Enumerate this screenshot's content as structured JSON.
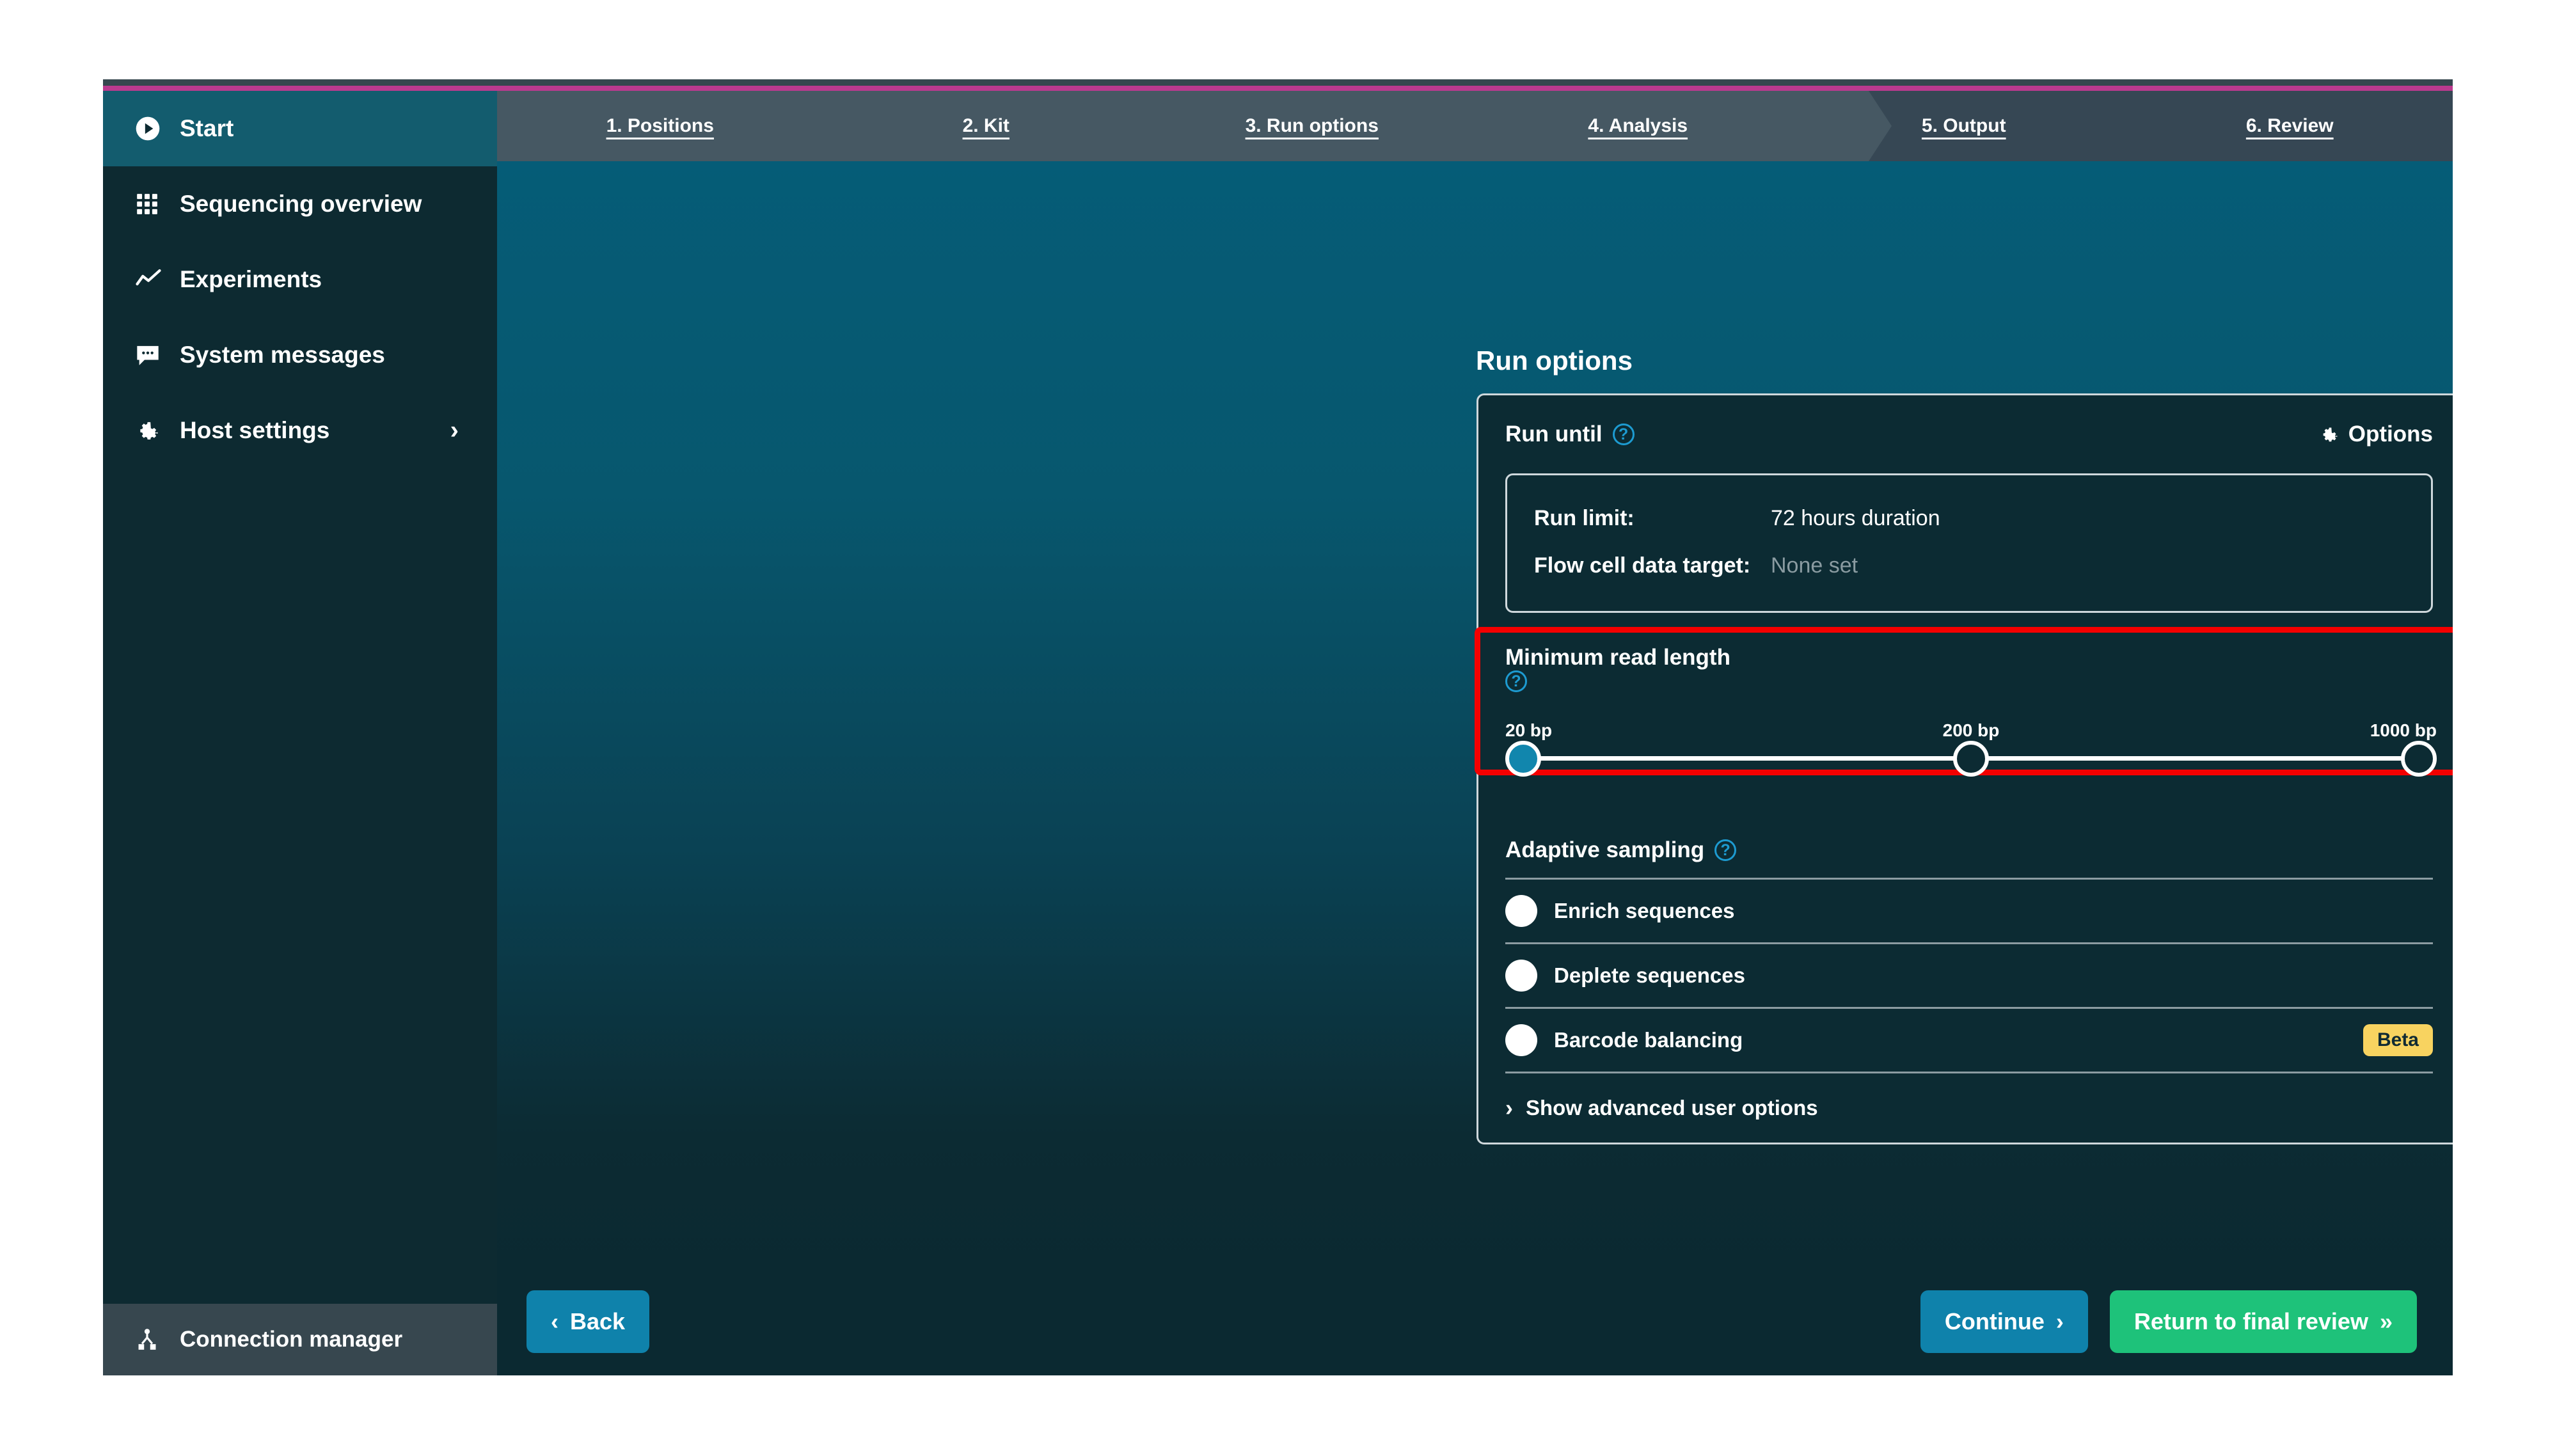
{
  "window": {
    "accent_magenta": "#bb3a8f",
    "accent_teal": "#0f82ab",
    "accent_green": "#1ec27a",
    "highlight_red": "#f40000",
    "badge_yellow": "#f8d360"
  },
  "sidebar": {
    "items": [
      {
        "label": "Start",
        "icon": "play-circle-icon",
        "active": true,
        "chevron": ""
      },
      {
        "label": "Sequencing overview",
        "icon": "grid-icon",
        "active": false,
        "chevron": ""
      },
      {
        "label": "Experiments",
        "icon": "line-chart-icon",
        "active": false,
        "chevron": ""
      },
      {
        "label": "System messages",
        "icon": "message-icon",
        "active": false,
        "chevron": ""
      },
      {
        "label": "Host settings",
        "icon": "gear-icon",
        "active": false,
        "chevron": "›"
      }
    ],
    "connection_manager": {
      "label": "Connection manager",
      "icon": "network-node-icon"
    }
  },
  "tabbar": {
    "tabs": [
      {
        "label": "1. Positions"
      },
      {
        "label": "2. Kit"
      },
      {
        "label": "3. Run options"
      },
      {
        "label": "4. Analysis"
      },
      {
        "label": "5. Output"
      },
      {
        "label": "6. Review"
      }
    ],
    "active_index": 2
  },
  "main": {
    "page_title": "Run options",
    "run_until": {
      "title": "Run until",
      "help_icon": "help-circle-icon",
      "options_label": "Options",
      "options_icon": "gear-icon",
      "rows": [
        {
          "key": "Run limit:",
          "value": "72 hours duration",
          "muted": false
        },
        {
          "key": "Flow cell data target:",
          "value": "None set",
          "muted": true
        }
      ]
    },
    "minimum_read_length": {
      "title": "Minimum read length",
      "help_icon": "help-circle-icon",
      "highlighted": true,
      "stops": [
        {
          "label": "20 bp",
          "value": 20,
          "selected": true
        },
        {
          "label": "200 bp",
          "value": 200,
          "selected": false
        },
        {
          "label": "1000 bp",
          "value": 1000,
          "selected": false
        }
      ]
    },
    "adaptive_sampling": {
      "title": "Adaptive sampling",
      "help_icon": "help-circle-icon",
      "toggles": [
        {
          "label": "Enrich sequences",
          "on": false,
          "badge": ""
        },
        {
          "label": "Deplete sequences",
          "on": false,
          "badge": ""
        },
        {
          "label": "Barcode balancing",
          "on": false,
          "badge": "Beta"
        }
      ]
    },
    "advanced": {
      "label": "Show advanced user options",
      "icon": "chevron-right-icon",
      "expanded": false
    }
  },
  "footer": {
    "back": {
      "label": "Back",
      "icon": "chevron-left-icon"
    },
    "continue": {
      "label": "Continue",
      "icon": "chevron-right-icon"
    },
    "return_review": {
      "label": "Return to final review",
      "icon": "chevron-double-right-icon"
    }
  }
}
